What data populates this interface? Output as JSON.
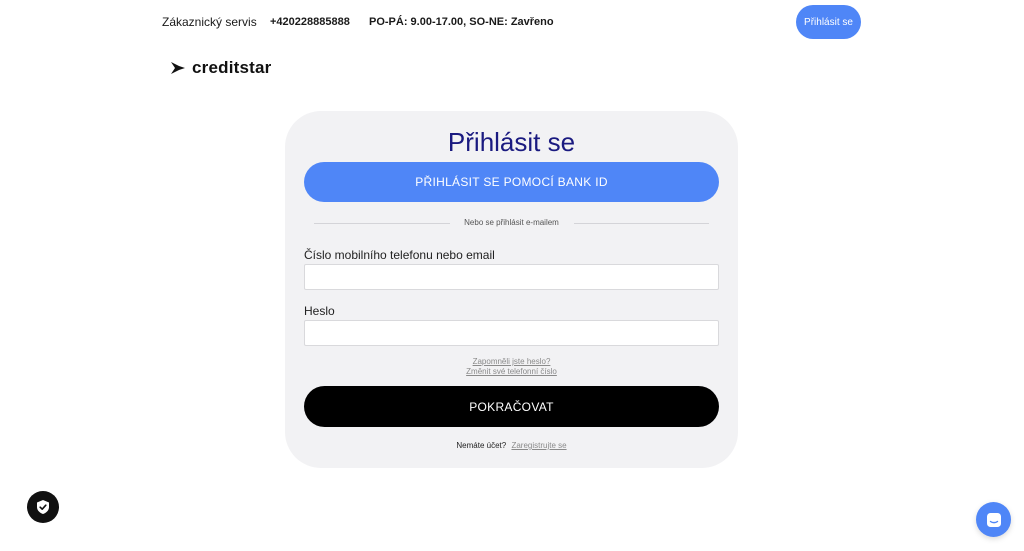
{
  "topbar": {
    "service_label": "Zákaznický servis",
    "phone": "+420228885888",
    "hours": "PO-PÁ: 9.00-17.00, SO-NE: Zavřeno",
    "login_label": "Přihlásit se"
  },
  "logo": {
    "text": "creditstar",
    "icon": "creditstar-logo-icon"
  },
  "form": {
    "title": "Přihlásit se",
    "bankid_label": "PŘIHLÁSIT SE POMOCÍ BANK ID",
    "divider_text": "Nebo se přihlásit e-mailem",
    "identifier_label": "Číslo mobilního telefonu nebo email",
    "identifier_value": "",
    "password_label": "Heslo",
    "password_value": "",
    "forgot_password_label": "Zapomněli jste heslo?",
    "change_phone_label": "Změnit své telefonní číslo",
    "continue_label": "POKRAČOVAT",
    "no_account_label": "Nemáte účet?",
    "register_label": "Zaregistrujte se"
  },
  "widgets": {
    "privacy_icon": "shield-check-icon",
    "chat_icon": "chat-icon"
  },
  "colors": {
    "accent": "#4f86f7",
    "title": "#1a1a80",
    "card_bg": "#f2f2f4",
    "primary_button": "#000000"
  }
}
